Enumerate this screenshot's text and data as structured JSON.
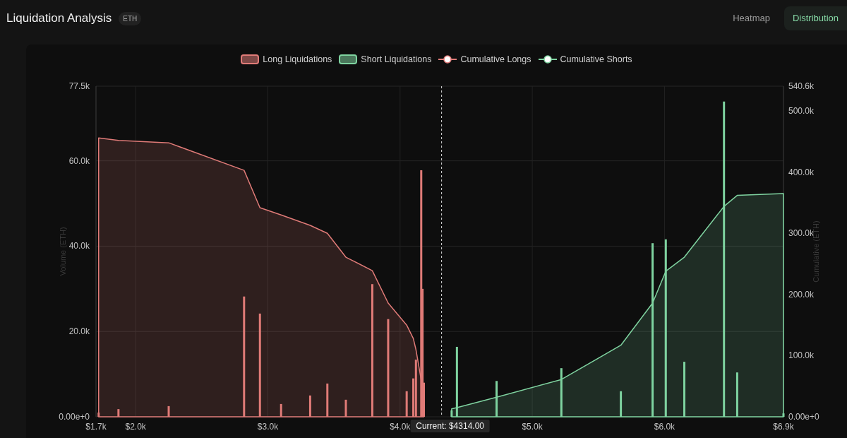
{
  "header": {
    "title": "Liquidation Analysis",
    "badge": "ETH"
  },
  "tabs": [
    {
      "label": "Heatmap",
      "selected": false
    },
    {
      "label": "Distribution",
      "selected": true
    }
  ],
  "chart_data": {
    "type": "bar",
    "grid": true,
    "ylabel": "Volume (ETH)",
    "y2label": "Cumulative (ETH)",
    "xlim": [
      1700,
      6900
    ],
    "ylim": [
      0,
      77500
    ],
    "y2lim": [
      0,
      540600
    ],
    "xticks": [
      {
        "value": 1700,
        "label": "$1.7k"
      },
      {
        "value": 2000,
        "label": "$2.0k"
      },
      {
        "value": 3000,
        "label": "$3.0k"
      },
      {
        "value": 4000,
        "label": "$4.0k"
      },
      {
        "value": 5000,
        "label": "$5.0k"
      },
      {
        "value": 6000,
        "label": "$6.0k"
      },
      {
        "value": 6900,
        "label": "$6.9k"
      }
    ],
    "yticks": [
      {
        "value": 0,
        "label": "0.00e+0"
      },
      {
        "value": 20000,
        "label": "20.0k"
      },
      {
        "value": 40000,
        "label": "40.0k"
      },
      {
        "value": 60000,
        "label": "60.0k"
      },
      {
        "value": 77500,
        "label": "77.5k"
      }
    ],
    "y2ticks": [
      {
        "value": 0,
        "label": "0.00e+0"
      },
      {
        "value": 100000,
        "label": "100.0k"
      },
      {
        "value": 200000,
        "label": "200.0k"
      },
      {
        "value": 300000,
        "label": "300.0k"
      },
      {
        "value": 400000,
        "label": "400.0k"
      },
      {
        "value": 500000,
        "label": "500.0k"
      },
      {
        "value": 540600,
        "label": "540.6k"
      }
    ],
    "x": [
      1720,
      1870,
      2250,
      2820,
      2940,
      3100,
      3320,
      3450,
      3590,
      3790,
      3910,
      4050,
      4100,
      4120,
      4160,
      4170,
      4180,
      4390,
      4430,
      4730,
      5220,
      5670,
      5910,
      6010,
      6150,
      6450,
      6550,
      6900
    ],
    "series": [
      {
        "name": "Long Liquidations",
        "type": "bar",
        "color": "#e07b78",
        "values": [
          1000,
          1800,
          2500,
          28200,
          24200,
          3000,
          5000,
          7800,
          4000,
          31100,
          22900,
          6000,
          9000,
          13400,
          57800,
          30000,
          8000,
          null,
          null,
          null,
          null,
          null,
          null,
          null,
          null,
          null,
          null,
          null
        ]
      },
      {
        "name": "Short Liquidations",
        "type": "bar",
        "color": "#7fd3a0",
        "values": [
          null,
          null,
          null,
          null,
          null,
          null,
          null,
          null,
          null,
          null,
          null,
          null,
          null,
          null,
          null,
          null,
          null,
          1500,
          16400,
          8400,
          11400,
          6000,
          40700,
          41600,
          12900,
          73900,
          10400,
          800
        ]
      },
      {
        "name": "Cumulative Longs",
        "type": "area",
        "axis": "y2",
        "color": "#e07b78",
        "values": [
          456000,
          452000,
          448000,
          403000,
          342000,
          330000,
          313000,
          300000,
          261000,
          239000,
          186000,
          150000,
          128000,
          110000,
          60000,
          20000,
          0,
          null,
          null,
          null,
          null,
          null,
          null,
          null,
          null,
          null,
          null,
          null
        ]
      },
      {
        "name": "Cumulative Shorts",
        "type": "area",
        "axis": "y2",
        "color": "#7fd3a0",
        "values": [
          null,
          null,
          null,
          null,
          null,
          null,
          null,
          null,
          null,
          null,
          null,
          null,
          null,
          null,
          null,
          null,
          null,
          13000,
          15000,
          32000,
          61000,
          117000,
          186000,
          238000,
          261000,
          344000,
          362000,
          365000
        ]
      }
    ],
    "ref_lines": [
      {
        "axis": "x",
        "value": 4314,
        "label": "Current: $4314.00"
      }
    ]
  }
}
